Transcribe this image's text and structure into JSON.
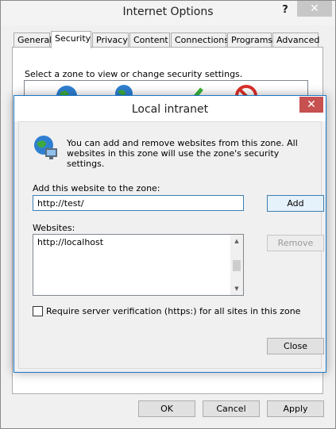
{
  "outer": {
    "title": "Internet Options",
    "help": "?",
    "close": "✕",
    "tabs": [
      "General",
      "Security",
      "Privacy",
      "Content",
      "Connections",
      "Programs",
      "Advanced"
    ],
    "zone_prompt": "Select a zone to view or change security settings.",
    "buttons": {
      "ok": "OK",
      "cancel": "Cancel",
      "apply": "Apply"
    }
  },
  "dialog": {
    "title": "Local intranet",
    "close": "✕",
    "info": "You can add and remove websites from this zone. All websites in this zone will use the zone's security settings.",
    "add_label": "Add this website to the zone:",
    "add_value": "http://test/",
    "add_button": "Add",
    "websites_label": "Websites:",
    "websites": [
      "http://localhost"
    ],
    "remove_button": "Remove",
    "require_https_label": "Require server verification (https:) for all sites in this zone",
    "require_https_checked": false,
    "close_button": "Close"
  },
  "colors": {
    "accent": "#1979ca",
    "close_red": "#c75050"
  }
}
